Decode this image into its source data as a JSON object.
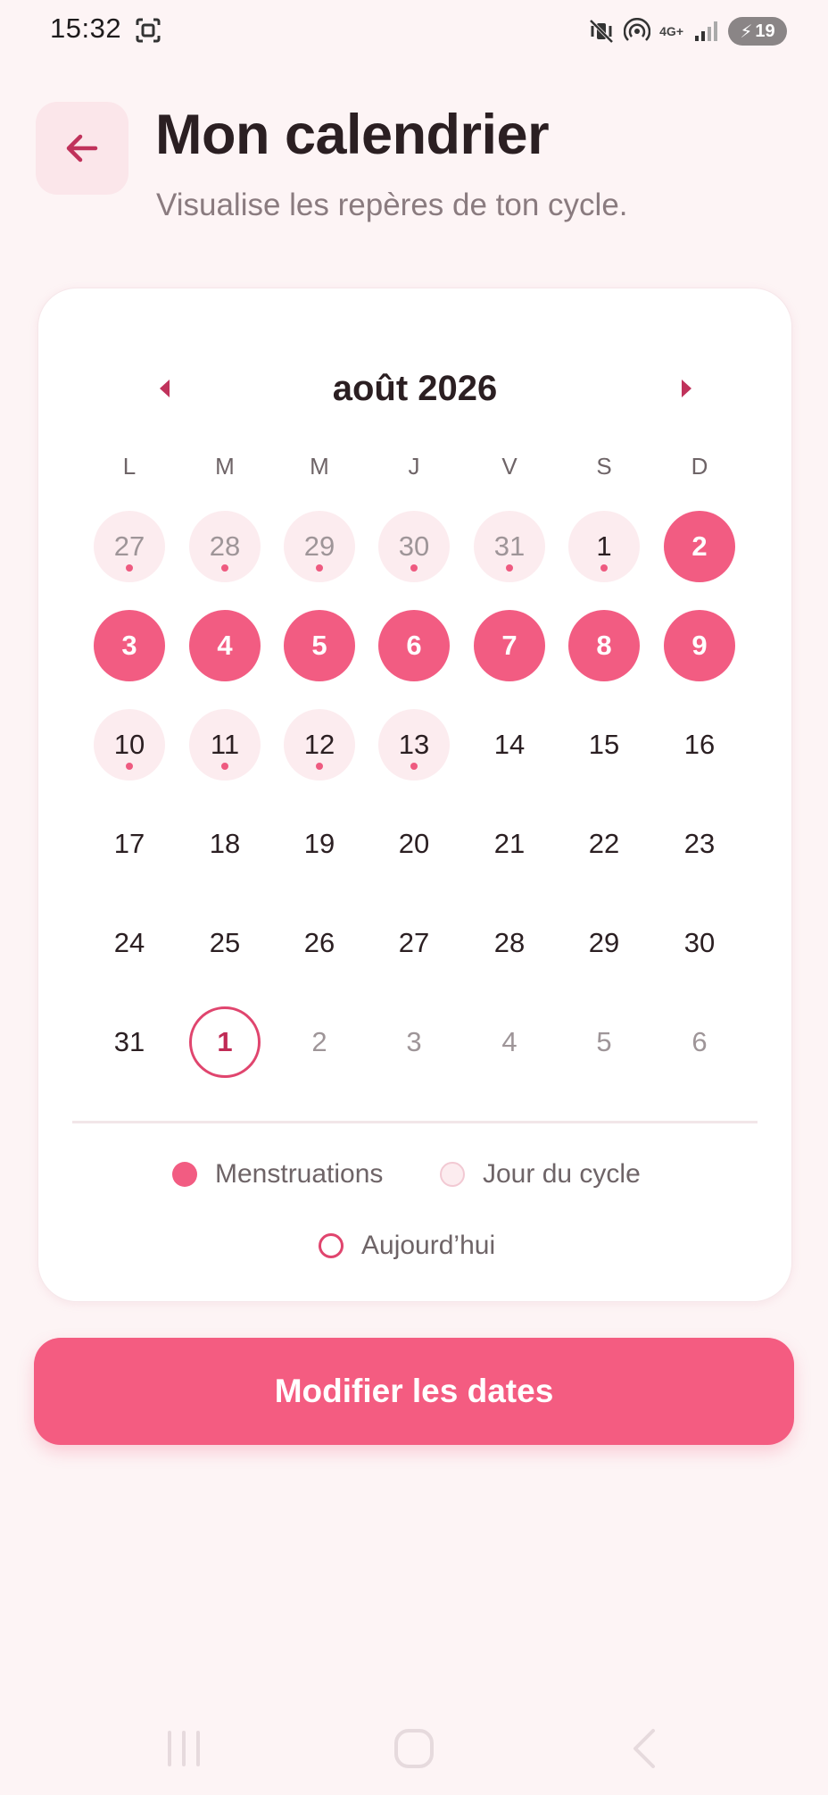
{
  "status_bar": {
    "time": "15:32",
    "network": "4G+",
    "battery": "19"
  },
  "header": {
    "title": "Mon calendrier",
    "subtitle": "Visualise les repères de ton cycle."
  },
  "calendar": {
    "month_label": "août 2026",
    "weekdays": [
      "L",
      "M",
      "M",
      "J",
      "V",
      "S",
      "D"
    ],
    "weeks": [
      [
        {
          "d": "27",
          "other": true,
          "cycle": true,
          "dot": true
        },
        {
          "d": "28",
          "other": true,
          "cycle": true,
          "dot": true
        },
        {
          "d": "29",
          "other": true,
          "cycle": true,
          "dot": true
        },
        {
          "d": "30",
          "other": true,
          "cycle": true,
          "dot": true
        },
        {
          "d": "31",
          "other": true,
          "cycle": true,
          "dot": true
        },
        {
          "d": "1",
          "cycle": true,
          "dot": true
        },
        {
          "d": "2",
          "period": true
        }
      ],
      [
        {
          "d": "3",
          "period": true
        },
        {
          "d": "4",
          "period": true
        },
        {
          "d": "5",
          "period": true
        },
        {
          "d": "6",
          "period": true
        },
        {
          "d": "7",
          "period": true
        },
        {
          "d": "8",
          "period": true
        },
        {
          "d": "9",
          "period": true
        }
      ],
      [
        {
          "d": "10",
          "cycle": true,
          "dot": true
        },
        {
          "d": "11",
          "cycle": true,
          "dot": true
        },
        {
          "d": "12",
          "cycle": true,
          "dot": true
        },
        {
          "d": "13",
          "cycle": true,
          "dot": true
        },
        {
          "d": "14"
        },
        {
          "d": "15"
        },
        {
          "d": "16"
        }
      ],
      [
        {
          "d": "17"
        },
        {
          "d": "18"
        },
        {
          "d": "19"
        },
        {
          "d": "20"
        },
        {
          "d": "21"
        },
        {
          "d": "22"
        },
        {
          "d": "23"
        }
      ],
      [
        {
          "d": "24"
        },
        {
          "d": "25"
        },
        {
          "d": "26"
        },
        {
          "d": "27"
        },
        {
          "d": "28"
        },
        {
          "d": "29"
        },
        {
          "d": "30"
        }
      ],
      [
        {
          "d": "31"
        },
        {
          "d": "1",
          "today": true
        },
        {
          "d": "2",
          "other": true
        },
        {
          "d": "3",
          "other": true
        },
        {
          "d": "4",
          "other": true
        },
        {
          "d": "5",
          "other": true
        },
        {
          "d": "6",
          "other": true
        }
      ]
    ]
  },
  "legend": {
    "period": "Menstruations",
    "cycle_day": "Jour du cycle",
    "today": "Aujourd’hui"
  },
  "actions": {
    "edit_dates": "Modifier les dates"
  },
  "colors": {
    "accent": "#f25c82",
    "cycle_bg": "#fcecef",
    "background": "#fdf4f5"
  }
}
